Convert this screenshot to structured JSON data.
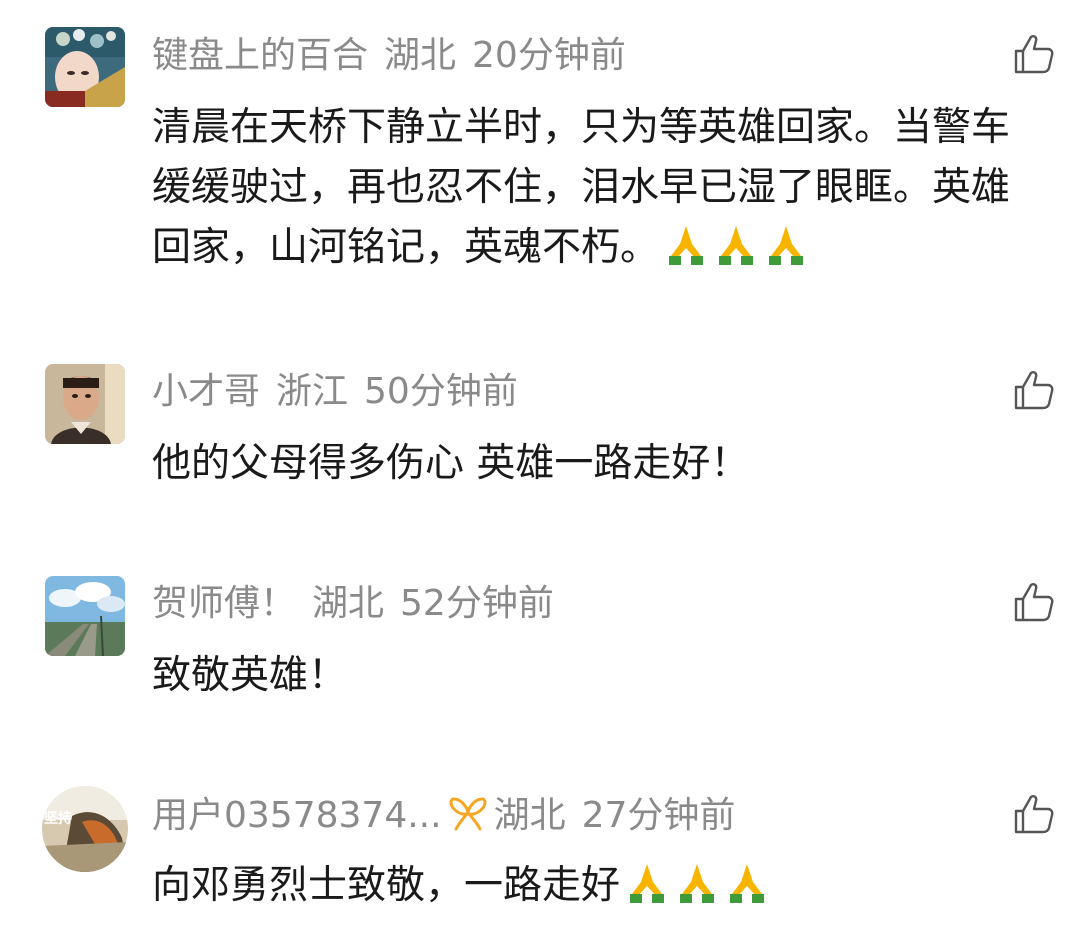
{
  "comments": [
    {
      "username": "键盘上的百合",
      "location": "湖北",
      "time": "20分钟前",
      "text": "清晨在天桥下静立半时，只为等英雄回家。当警车缓缓驶过，再也忍不住，泪水早已湿了眼眶。英雄回家，山河铭记，英魂不朽。",
      "emoji": [
        "folded-hands-icon",
        "folded-hands-icon",
        "folded-hands-icon"
      ]
    },
    {
      "username": "小才哥",
      "location": "浙江",
      "time": "50分钟前",
      "text": "他的父母得多伤心 英雄一路走好！",
      "emoji": []
    },
    {
      "username": "贺师傅！",
      "location": "湖北",
      "time": "52分钟前",
      "text": "致敬英雄！",
      "emoji": []
    },
    {
      "username": "用户03578374...",
      "location": "湖北",
      "time": "27分钟前",
      "text": "向邓勇烈士致敬，一路走好",
      "emoji": [
        "folded-hands-icon",
        "folded-hands-icon",
        "folded-hands-icon"
      ],
      "avatar_caption": "坚持"
    }
  ],
  "icons": {
    "like": "thumbs-up-outline-icon",
    "badge": "orange-ribbon-badge-icon"
  },
  "colors": {
    "meta_text": "#8a8a8a",
    "body_text": "#1a1a1a",
    "badge": "#f5a623",
    "emoji_skin": "#f7b500",
    "emoji_sleeve": "#3f9b3a"
  }
}
